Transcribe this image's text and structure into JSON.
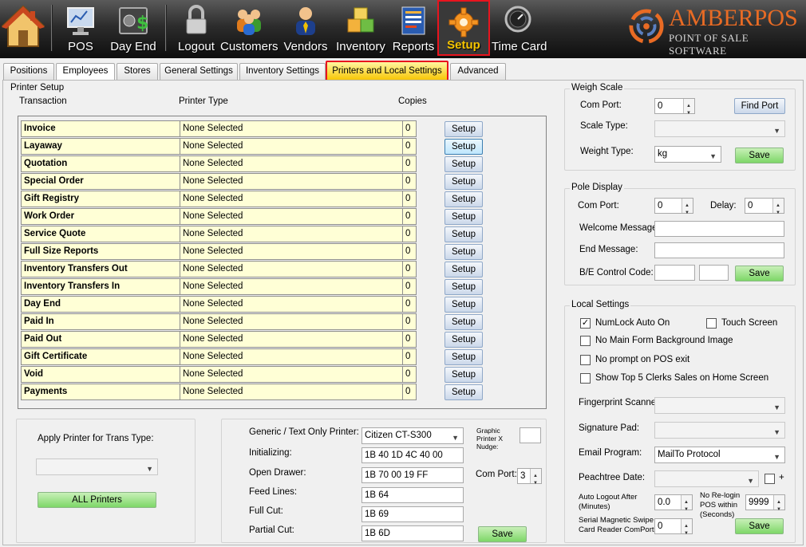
{
  "toolbar": {
    "items": [
      {
        "label": "",
        "icon": "home-icon"
      },
      {
        "label": "POS",
        "icon": "monitor-icon"
      },
      {
        "label": "Day End",
        "icon": "safe-icon"
      },
      {
        "label": "Logout",
        "icon": "padlock-icon"
      },
      {
        "label": "Customers",
        "icon": "people-icon"
      },
      {
        "label": "Vendors",
        "icon": "person-tie-icon"
      },
      {
        "label": "Inventory",
        "icon": "boxes-icon"
      },
      {
        "label": "Reports",
        "icon": "report-icon"
      },
      {
        "label": "Setup",
        "icon": "gear-icon"
      },
      {
        "label": "Time Card",
        "icon": "clock-icon"
      }
    ],
    "logo_title": "AMBERPOS",
    "logo_subtitle": "POINT OF SALE SOFTWARE"
  },
  "tabs": [
    "Positions",
    "Employees",
    "Stores",
    "General Settings",
    "Inventory Settings",
    "Printers and Local Settings",
    "Advanced"
  ],
  "printer_setup": {
    "title": "Printer Setup",
    "col_transaction": "Transaction",
    "col_printer_type": "Printer Type",
    "col_copies": "Copies",
    "rows": [
      {
        "name": "Invoice",
        "printer": "None Selected",
        "copies": "0",
        "button": "Setup"
      },
      {
        "name": "Layaway",
        "printer": "None Selected",
        "copies": "0",
        "button": "Setup"
      },
      {
        "name": "Quotation",
        "printer": "None Selected",
        "copies": "0",
        "button": "Setup"
      },
      {
        "name": "Special Order",
        "printer": "None Selected",
        "copies": "0",
        "button": "Setup"
      },
      {
        "name": "Gift Registry",
        "printer": "None Selected",
        "copies": "0",
        "button": "Setup"
      },
      {
        "name": "Work Order",
        "printer": "None Selected",
        "copies": "0",
        "button": "Setup"
      },
      {
        "name": "Service Quote",
        "printer": "None Selected",
        "copies": "0",
        "button": "Setup"
      },
      {
        "name": "Full Size Reports",
        "printer": "None Selected",
        "copies": "0",
        "button": "Setup"
      },
      {
        "name": "Inventory Transfers Out",
        "printer": "None Selected",
        "copies": "0",
        "button": "Setup"
      },
      {
        "name": "Inventory Transfers In",
        "printer": "None Selected",
        "copies": "0",
        "button": "Setup"
      },
      {
        "name": "Day End",
        "printer": "None Selected",
        "copies": "0",
        "button": "Setup"
      },
      {
        "name": "Paid In",
        "printer": "None Selected",
        "copies": "0",
        "button": "Setup"
      },
      {
        "name": "Paid Out",
        "printer": "None Selected",
        "copies": "0",
        "button": "Setup"
      },
      {
        "name": "Gift Certificate",
        "printer": "None Selected",
        "copies": "0",
        "button": "Setup"
      },
      {
        "name": "Void",
        "printer": "None Selected",
        "copies": "0",
        "button": "Setup"
      },
      {
        "name": "Payments",
        "printer": "None Selected",
        "copies": "0",
        "button": "Setup"
      }
    ]
  },
  "apply_printer": {
    "label": "Apply Printer for Trans Type:",
    "select_value": "",
    "button": "ALL Printers"
  },
  "generic_printer": {
    "label": "Generic / Text Only Printer:",
    "value": "Citizen CT-S300",
    "graphic_nudge_label": "Graphic Printer X Nudge:",
    "graphic_nudge_value": "",
    "initializing_label": "Initializing:",
    "initializing_value": "1B 40 1D 4C 40 00",
    "open_drawer_label": "Open Drawer:",
    "open_drawer_value": "1B 70 00 19 FF",
    "feed_lines_label": "Feed Lines:",
    "feed_lines_value": "1B 64",
    "full_cut_label": "Full Cut:",
    "full_cut_value": "1B 69",
    "partial_cut_label": "Partial Cut:",
    "partial_cut_value": "1B 6D",
    "com_port_label": "Com Port:",
    "com_port_value": "3",
    "save": "Save"
  },
  "weigh_scale": {
    "title": "Weigh Scale",
    "com_port_label": "Com Port:",
    "com_port_value": "0",
    "find_port": "Find Port",
    "scale_type_label": "Scale Type:",
    "scale_type_value": "",
    "weight_type_label": "Weight Type:",
    "weight_type_value": "kg",
    "save": "Save"
  },
  "pole_display": {
    "title": "Pole Display",
    "com_port_label": "Com Port:",
    "com_port_value": "0",
    "delay_label": "Delay:",
    "delay_value": "0",
    "welcome_label": "Welcome Message:",
    "welcome_value": "",
    "end_label": "End Message:",
    "end_value": "",
    "be_label": "B/E Control Code:",
    "b_value": "",
    "e_value": "",
    "save": "Save"
  },
  "local_settings": {
    "title": "Local Settings",
    "numlock": "NumLock Auto On",
    "numlock_checked": true,
    "touch_screen": "Touch Screen",
    "touch_checked": false,
    "no_bg": "No Main Form  Background Image",
    "no_bg_checked": false,
    "no_prompt": "No prompt on POS exit",
    "no_prompt_checked": false,
    "show_top": "Show Top 5 Clerks Sales on Home Screen",
    "show_top_checked": false,
    "fingerprint_label": "Fingerprint Scanner:",
    "fingerprint_value": "",
    "signature_label": "Signature Pad:",
    "signature_value": "",
    "email_label": "Email Program:",
    "email_value": "MailTo Protocol",
    "peachtree_label": "Peachtree Date:",
    "peachtree_value": "",
    "peachtree_plus": "+",
    "auto_logout_label": "Auto Logout After (Minutes)",
    "auto_logout_value": "0.0",
    "relogin_label": "No Re-login POS within (Seconds)",
    "relogin_value": "9999",
    "serial_label": "Serial Magnetic Swipe Card Reader ComPort",
    "serial_value": "0",
    "save": "Save"
  },
  "colors": {
    "accent_red": "#e8141e",
    "tab_highlight": "#f7c400",
    "cell_yellow": "#ffffd6",
    "save_green": "#7ed768",
    "logo_orange": "#e96b24"
  }
}
